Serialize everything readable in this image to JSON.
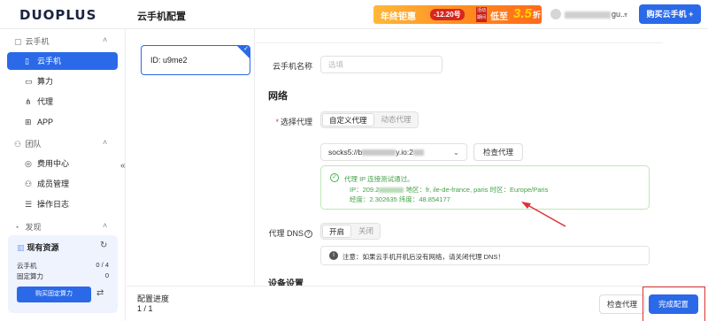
{
  "topbar": {
    "logo": "DUOPLUS",
    "page_title": "云手机配置",
    "promo": {
      "part1": "年终钜惠",
      "part2": "-12.20号",
      "part3": "活动期间",
      "part4": "低至",
      "part5": "3.5",
      "part6": "折"
    },
    "user_email_suffix": "gu...",
    "buy_button": "购买云手机 +"
  },
  "sidebar": {
    "groups": [
      {
        "label": "云手机",
        "icon": "phone-outline-icon"
      },
      {
        "label": "团队",
        "icon": "team-icon"
      },
      {
        "label": "发现",
        "icon": "compass-icon"
      }
    ],
    "items": [
      {
        "label": "云手机",
        "icon": "phone-icon",
        "active": true
      },
      {
        "label": "算力",
        "icon": "monitor-icon",
        "active": false
      },
      {
        "label": "代理",
        "icon": "proxy-icon",
        "active": false
      },
      {
        "label": "APP",
        "icon": "grid-icon",
        "active": false
      },
      {
        "label": "费用中心",
        "icon": "coin-icon",
        "active": false
      },
      {
        "label": "成员管理",
        "icon": "members-icon",
        "active": false
      },
      {
        "label": "操作日志",
        "icon": "log-icon",
        "active": false
      }
    ],
    "resources": {
      "title": "现有资源",
      "rows": [
        {
          "label": "云手机",
          "value": "0 / 4"
        },
        {
          "label": "固定算力",
          "value": "0"
        }
      ],
      "button": "购买固定算力"
    }
  },
  "config_list": {
    "card_id": "ID: u9me2"
  },
  "form": {
    "name_label": "云手机名称",
    "name_placeholder": "选填",
    "network_title": "网络",
    "proxy_label": "选择代理",
    "proxy_tabs": [
      "自定义代理",
      "动态代理"
    ],
    "proxy_value_prefix": "socks5://b",
    "proxy_value_mid": "y.io:2",
    "check_proxy_button": "检查代理",
    "proxy_result": {
      "title": "代理 IP 连接测试通过。",
      "ip_prefix": "IP：209.2",
      "ip_suffix": "地区：fr, ile-de-france, paris  时区：Europe/Paris",
      "coords": "经度：2.302635  纬度：48.854177"
    },
    "dns_label": "代理 DNS",
    "dns_options": [
      "开启",
      "关闭"
    ],
    "dns_note": "注意：如果云手机开机后没有网络，请关闭代理 DNS！",
    "next_section": "设备设置"
  },
  "bottombar": {
    "progress_label": "配置进度",
    "progress_value": "1 / 1",
    "check_proxy_button": "检查代理",
    "finish_button": "完成配置"
  },
  "colors": {
    "primary": "#2a69e8",
    "success": "#43a047",
    "annotation": "#d33"
  }
}
